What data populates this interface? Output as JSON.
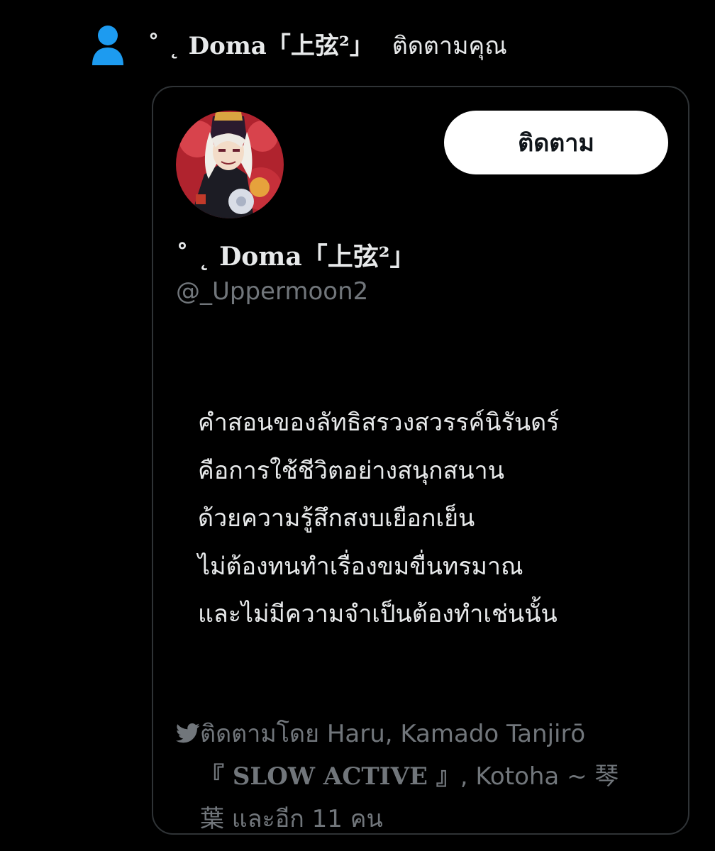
{
  "notification": {
    "icon": "person-icon",
    "name_text": "˚ ˛ Doma「上弦²」",
    "suffix": "ติดตามคุณ",
    "icon_color": "#1d9bf0"
  },
  "profile": {
    "avatar_icon": "avatar",
    "follow_button_label": "ติดตาม",
    "display_name": "˚ ˛ Doma「上弦²」",
    "handle": "@_Uppermoon2",
    "bio_lines": [
      "คำสอนของลัทธิสรวงสวรรค์นิรันดร์",
      "คือการใช้ชีวิตอย่างสนุกสนาน",
      "ด้วยความรู้สึกสงบเยือกเย็น",
      "ไม่ต้องทนทำเรื่องขมขื่นทรมาณ",
      "และไม่มีความจำเป็นต้องทำเช่นนั้น"
    ],
    "followed_by": {
      "bird_icon": "bird-icon",
      "line1": "ติดตามโดย Haru, Kamado Tanjirō",
      "line2_serif": "『 SLOW ACTIVE 』",
      "line2_rest": ", Kotoha ~ 琴",
      "line3": "葉 และอีก 11 คน"
    }
  },
  "colors": {
    "background": "#000000",
    "text": "#e7e9ea",
    "secondary_text": "#71767b",
    "border": "#2f3336",
    "accent": "#1d9bf0",
    "button_bg": "#ffffff"
  }
}
